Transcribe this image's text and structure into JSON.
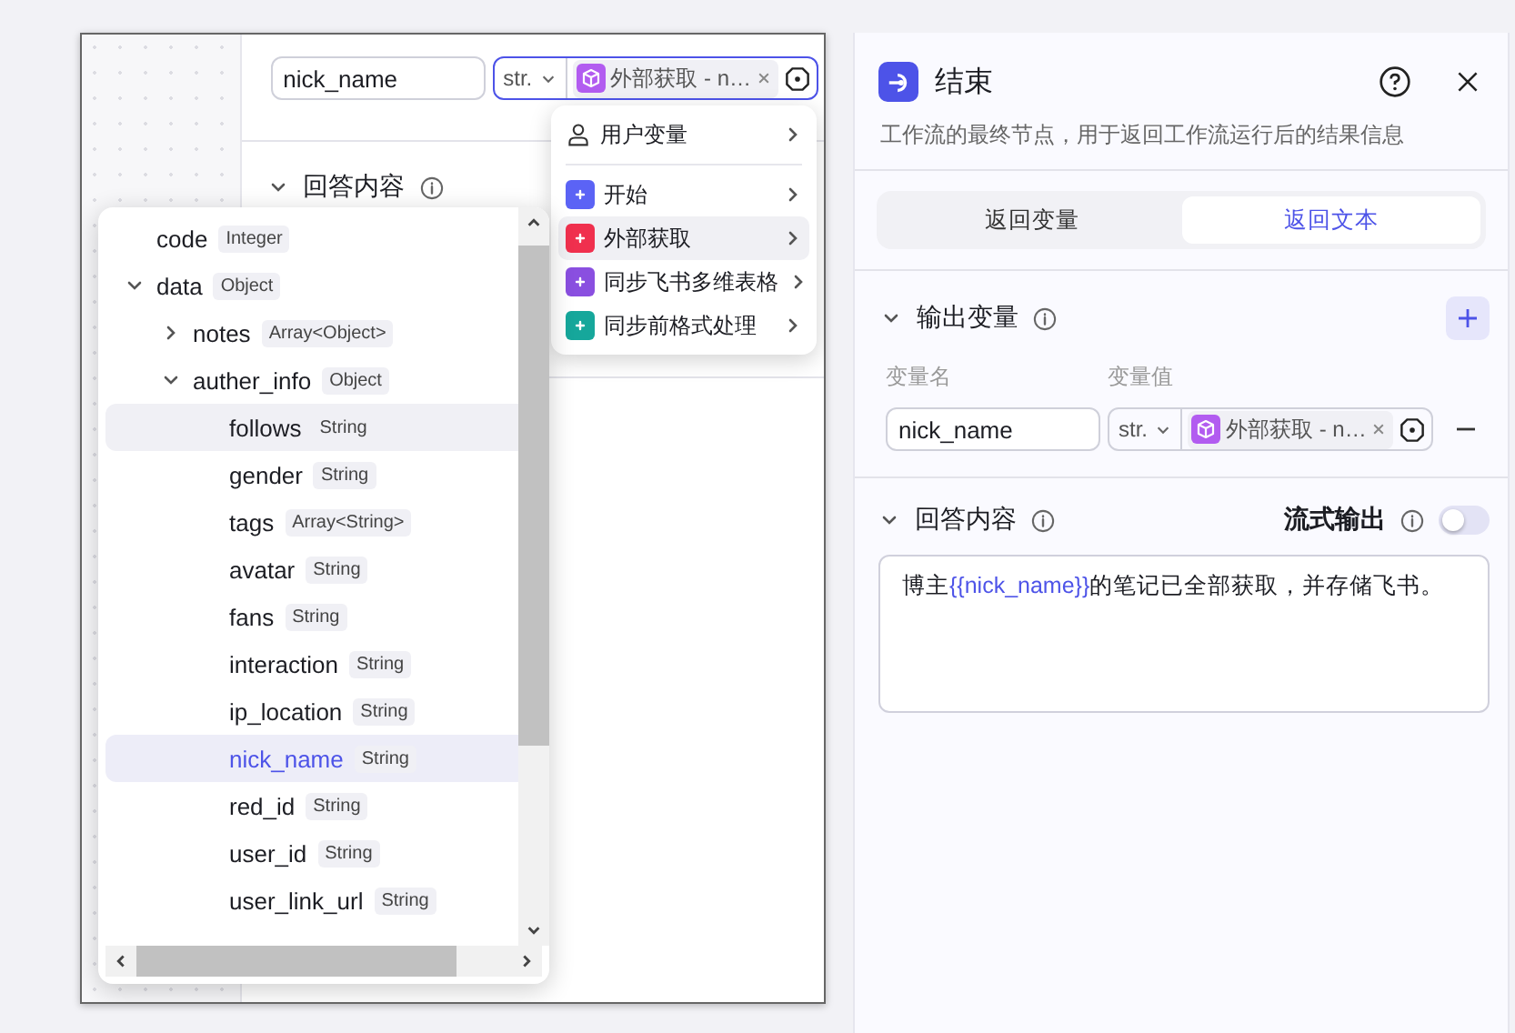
{
  "editor": {
    "field_row": {
      "name": "nick_name",
      "type": "str.",
      "value_tag": "外部获取 - n…",
      "focused": true
    },
    "section": {
      "title": "回答内容",
      "expanded": true
    }
  },
  "source_menu": {
    "items": [
      {
        "label": "用户变量",
        "kind": "user",
        "selected": false
      },
      {
        "label": "开始",
        "kind": "node",
        "color": "#5b63f5",
        "selected": false
      },
      {
        "label": "外部获取",
        "kind": "node",
        "color": "#f0304e",
        "selected": true
      },
      {
        "label": "同步飞书多维表格",
        "kind": "node",
        "color": "#8a4fe0",
        "selected": false
      },
      {
        "label": "同步前格式处理",
        "kind": "node",
        "color": "#16a79b",
        "selected": false
      }
    ]
  },
  "tree": {
    "items": [
      {
        "name": "code",
        "type": "Integer",
        "selected": false,
        "highlighted": false
      },
      {
        "name": "data",
        "type": "Object",
        "expanded": true,
        "selected": false,
        "highlighted": false,
        "children": [
          {
            "name": "notes",
            "type": "Array<Object>",
            "expanded": false,
            "selected": false,
            "highlighted": false
          },
          {
            "name": "auther_info",
            "type": "Object",
            "expanded": true,
            "selected": false,
            "highlighted": false,
            "children": [
              {
                "name": "follows",
                "type": "String",
                "selected": false,
                "highlighted": true
              },
              {
                "name": "gender",
                "type": "String",
                "selected": false,
                "highlighted": false
              },
              {
                "name": "tags",
                "type": "Array<String>",
                "selected": false,
                "highlighted": false
              },
              {
                "name": "avatar",
                "type": "String",
                "selected": false,
                "highlighted": false
              },
              {
                "name": "fans",
                "type": "String",
                "selected": false,
                "highlighted": false
              },
              {
                "name": "interaction",
                "type": "String",
                "selected": false,
                "highlighted": false
              },
              {
                "name": "ip_location",
                "type": "String",
                "selected": false,
                "highlighted": false
              },
              {
                "name": "nick_name",
                "type": "String",
                "selected": true,
                "highlighted": false
              },
              {
                "name": "red_id",
                "type": "String",
                "selected": false,
                "highlighted": false
              },
              {
                "name": "user_id",
                "type": "String",
                "selected": false,
                "highlighted": false
              },
              {
                "name": "user_link_url",
                "type": "String",
                "selected": false,
                "highlighted": false
              }
            ]
          }
        ]
      }
    ]
  },
  "end_panel": {
    "title": "结束",
    "description": "工作流的最终节点，用于返回工作流运行后的结果信息",
    "tabs": [
      {
        "label": "返回变量",
        "selected": false
      },
      {
        "label": "返回文本",
        "selected": true
      }
    ],
    "output_section": {
      "title": "输出变量",
      "expanded": true,
      "columns": [
        "变量名",
        "变量值"
      ],
      "rows": [
        {
          "name": "nick_name",
          "type": "str.",
          "value_tag": "外部获取 - n…"
        }
      ]
    },
    "answer_section": {
      "title": "回答内容",
      "expanded": true,
      "streaming_label": "流式输出",
      "streaming": false,
      "content": [
        {
          "text": "博主",
          "kind": "plain"
        },
        {
          "text": "{{nick_name}}",
          "kind": "variable"
        },
        {
          "text": "的笔记已全部获取，并存储飞书。",
          "kind": "plain"
        }
      ]
    }
  }
}
